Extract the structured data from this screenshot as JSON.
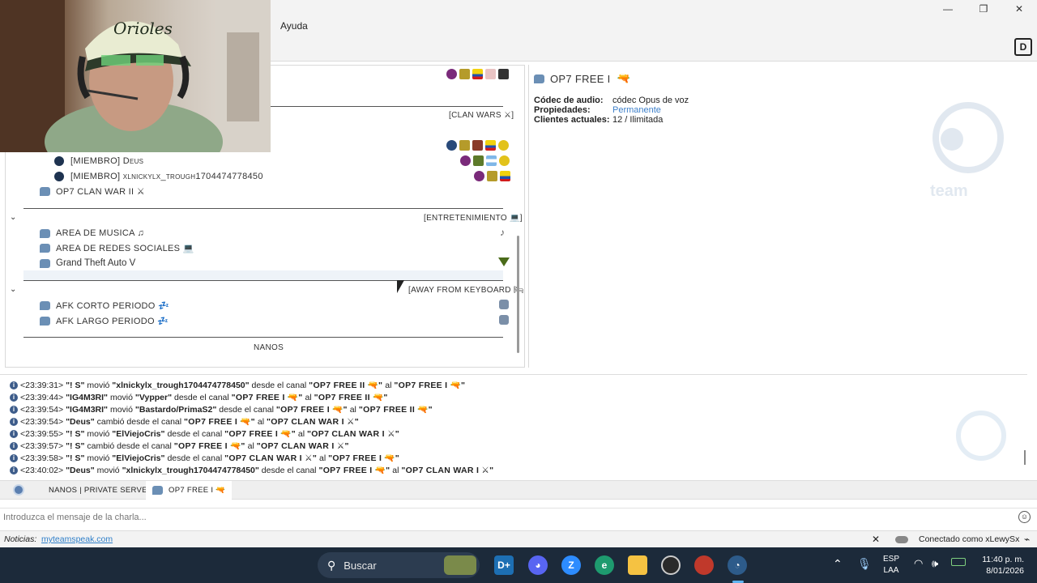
{
  "window": {
    "controls": [
      "—",
      "❐",
      "✕"
    ]
  },
  "menu": {
    "items": [
      "Ayuda"
    ]
  },
  "tree": {
    "channels": {
      "clan_wars": {
        "label": "[CLAN WARS ⚔]"
      },
      "member1": {
        "label": "[MIEMBRO] Deus"
      },
      "member2": {
        "label": "[MIEMBRO] xlnickylx_trough1704474778450"
      },
      "op7_clan_war_ii": {
        "label": "OP7 CLAN WAR II ⚔"
      },
      "entretenimiento": {
        "label": "[ENTRETENIMIENTO 💻]"
      },
      "musica": {
        "label": "AREA DE MUSICA ♫"
      },
      "redes": {
        "label": "AREA DE REDES SOCIALES 💻"
      },
      "gta": {
        "label": "Grand Theft Auto V"
      },
      "afk": {
        "label": "[AWAY FROM KEYBOARD 🛏]"
      },
      "afk_corto": {
        "label": "AFK CORTO PERIODO 💤"
      },
      "afk_largo": {
        "label": "AFK LARGO PERIODO 💤"
      },
      "nanos": {
        "label": "NANOS"
      }
    }
  },
  "info": {
    "title": "OP7 FREE I",
    "rows": [
      {
        "key": "Códec de audio:",
        "value": "códec Opus de voz"
      },
      {
        "key": "Propiedades:",
        "value": "Permanente"
      },
      {
        "key": "Clientes actuales:",
        "value": "12 / Ilimitada"
      }
    ],
    "watermark": "team"
  },
  "log": [
    {
      "time": "<23:39:31>",
      "user": "\"!        S\"",
      "action": "movió",
      "target": "\"xlnickylx_trough1704474778450\"",
      "mid": "desde el canal",
      "from": "\"OP7 FREE II 🔫\"",
      "to_word": "al",
      "to": "\"OP7 FREE I 🔫\""
    },
    {
      "time": "<23:39:44>",
      "user": "\"IG4M3RI\"",
      "action": "movió",
      "target": "\"Vypper\"",
      "mid": "desde el canal",
      "from": "\"OP7 FREE I 🔫\"",
      "to_word": "al",
      "to": "\"OP7 FREE II 🔫\""
    },
    {
      "time": "<23:39:54>",
      "user": "\"IG4M3RI\"",
      "action": "movió",
      "target": "\"Bastardo/PrimaS2\"",
      "mid": "desde el canal",
      "from": "\"OP7 FREE I 🔫\"",
      "to_word": "al",
      "to": "\"OP7 FREE II 🔫\""
    },
    {
      "time": "<23:39:54>",
      "user": "\"Deus\"",
      "action": "cambió desde el canal",
      "target": "",
      "mid": "",
      "from": "\"OP7 FREE I 🔫\"",
      "to_word": "al",
      "to": "\"OP7 CLAN WAR I ⚔\""
    },
    {
      "time": "<23:39:55>",
      "user": "\"!        S\"",
      "action": "movió",
      "target": "\"ElViejoCris\"",
      "mid": "desde el canal",
      "from": "\"OP7 FREE I 🔫\"",
      "to_word": "al",
      "to": "\"OP7 CLAN WAR I ⚔\""
    },
    {
      "time": "<23:39:57>",
      "user": "\"!        S\"",
      "action": "cambió desde el canal",
      "target": "",
      "mid": "",
      "from": "\"OP7 FREE I 🔫\"",
      "to_word": "al",
      "to": "\"OP7 CLAN WAR I ⚔\""
    },
    {
      "time": "<23:39:58>",
      "user": "\"!        S\"",
      "action": "movió",
      "target": "\"ElViejoCris\"",
      "mid": "desde el canal",
      "from": "\"OP7 CLAN WAR I ⚔\"",
      "to_word": "al",
      "to": "\"OP7 FREE I 🔫\""
    },
    {
      "time": "<23:40:02>",
      "user": "\"Deus\"",
      "action": "movió",
      "target": "\"xlnickylx_trough1704474778450\"",
      "mid": "desde el canal",
      "from": "\"OP7 FREE I 🔫\"",
      "to_word": "al",
      "to": "\"OP7 CLAN WAR I ⚔\""
    }
  ],
  "tabs": {
    "server": "NANOS | PRIVATE SERVER",
    "channel": "OP7 FREE I 🔫"
  },
  "chat": {
    "placeholder": "Introduzca el mensaje de la charla..."
  },
  "status": {
    "news_label": "Noticias:",
    "news_link": "myteamspeak.com",
    "close": "✕",
    "connected": "Conectado como xLewySx"
  },
  "taskbar": {
    "search": "Buscar",
    "lang": "ESP",
    "lang2": "LAA",
    "time": "11:40 p. m.",
    "date": "8/01/2026"
  },
  "colors": {
    "accent": "#3d7fc9",
    "link": "#2f7fc9"
  }
}
